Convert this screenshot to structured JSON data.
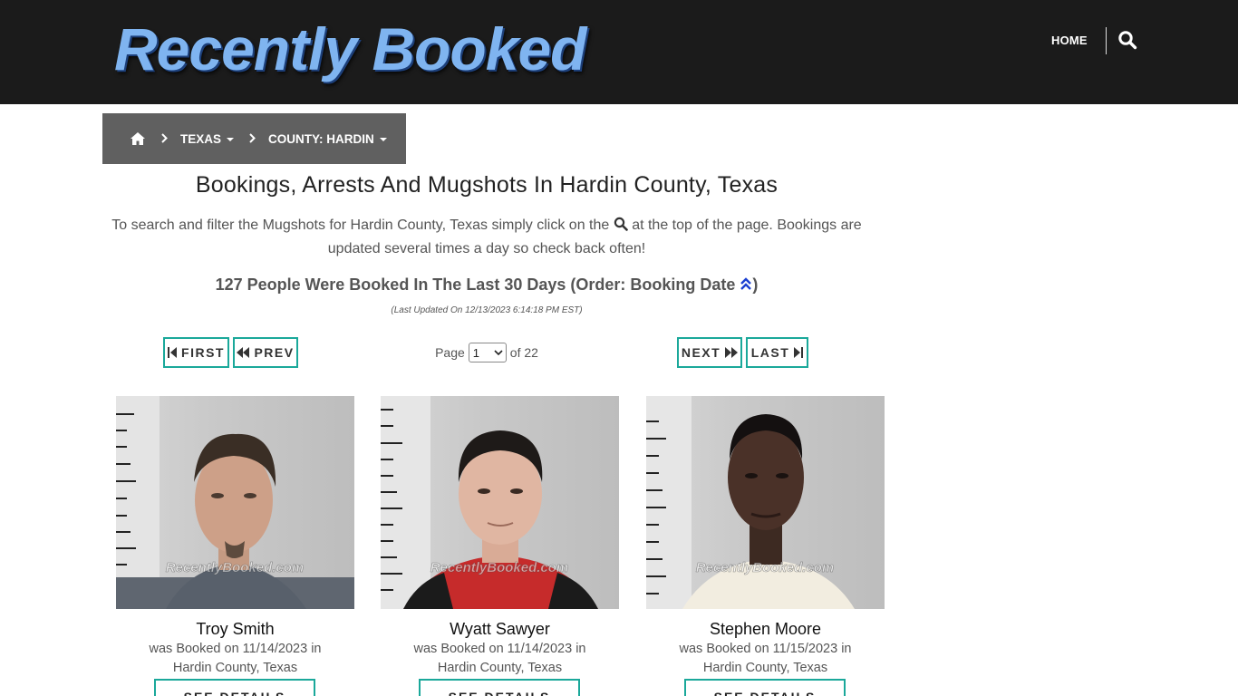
{
  "header": {
    "logo_text": "Recently Booked",
    "nav_home": "HOME",
    "search_icon": "search-icon"
  },
  "breadcrumb": {
    "home_icon": "home-icon",
    "state": "TEXAS",
    "county": "COUNTY: HARDIN"
  },
  "main": {
    "title": "Bookings, Arrests And Mugshots In Hardin County, Texas",
    "intro_part1": "To search and filter the Mugshots for Hardin County, Texas simply click on the",
    "intro_part2": "at the top of the page. Bookings are updated several times a day so check back often!",
    "count_line": "127 People Were Booked In The Last 30 Days (Order: Booking Date",
    "count_close": ")",
    "last_updated": "(Last Updated On 12/13/2023 6:14:18 PM EST)"
  },
  "pager": {
    "first": "FIRST",
    "prev": "PREV",
    "next": "NEXT",
    "last": "LAST",
    "page_label": "Page",
    "current_page": "1",
    "of_label": "of 22"
  },
  "watermark": "RecentlyBooked.com",
  "cards": [
    {
      "name": "Troy Smith",
      "booked_line": "was Booked on 11/14/2023 in",
      "location": "Hardin County, Texas",
      "button": "SEE DETAILS"
    },
    {
      "name": "Wyatt Sawyer",
      "booked_line": "was Booked on 11/14/2023 in",
      "location": "Hardin County, Texas",
      "button": "SEE DETAILS"
    },
    {
      "name": "Stephen Moore",
      "booked_line": "was Booked on 11/15/2023 in",
      "location": "Hardin County, Texas",
      "button": "SEE DETAILS"
    }
  ],
  "colors": {
    "header_bg": "#1b1b1b",
    "breadcrumb_bg": "#606060",
    "button_border": "#1aa89a",
    "sort_icon": "#1a3fd1"
  }
}
